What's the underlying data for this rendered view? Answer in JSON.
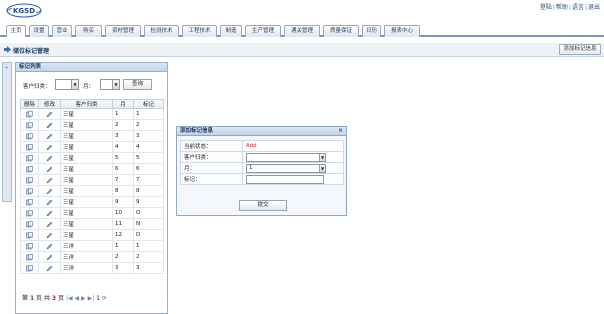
{
  "logo_text": "KGSD",
  "top_links": [
    "登陆",
    "帮助",
    "语言",
    "退出"
  ],
  "nav_tabs": [
    "主页",
    "设置",
    "营业",
    "购买",
    "资材管理",
    "检测技术",
    "工程技术",
    "制造",
    "生产管理",
    "通关管理",
    "质量保证",
    "日历",
    "报表中心"
  ],
  "breadcrumb": {
    "title": "储位标记管理",
    "add_button": "添加标记信息"
  },
  "panel": {
    "title": "标记列表",
    "filter": {
      "customer_label": "客户归类：",
      "month_label": "月：",
      "query_button": "查询"
    },
    "columns": [
      "删除",
      "修改",
      "客户归类",
      "月",
      "标记"
    ],
    "rows": [
      [
        "三星",
        "1",
        "1"
      ],
      [
        "三星",
        "2",
        "2"
      ],
      [
        "三星",
        "3",
        "3"
      ],
      [
        "三星",
        "4",
        "4"
      ],
      [
        "三星",
        "5",
        "5"
      ],
      [
        "三星",
        "6",
        "6"
      ],
      [
        "三星",
        "7",
        "7"
      ],
      [
        "三星",
        "8",
        "8"
      ],
      [
        "三星",
        "9",
        "9"
      ],
      [
        "三星",
        "10",
        "O"
      ],
      [
        "三星",
        "11",
        "N"
      ],
      [
        "三星",
        "12",
        "D"
      ],
      [
        "三洋",
        "1",
        "1"
      ],
      [
        "三洋",
        "2",
        "2"
      ],
      [
        "三洋",
        "3",
        "3"
      ]
    ],
    "pager": {
      "prefix": "第",
      "current": "1",
      "mid": "页 共",
      "total": "3",
      "suffix": "页",
      "page_input": "1"
    }
  },
  "dialog": {
    "title": "添加标记信息",
    "status_label": "当前状态：",
    "status_value": "Add",
    "customer_label": "客户归类：",
    "customer_value": "",
    "month_label": "月：",
    "month_value": "1",
    "flag_label": "标记：",
    "flag_value": "",
    "submit": "提交"
  },
  "colors": {
    "nav_line": "#7d96b8",
    "status_red": "#e02020",
    "panel_border": "#99b0cc"
  }
}
